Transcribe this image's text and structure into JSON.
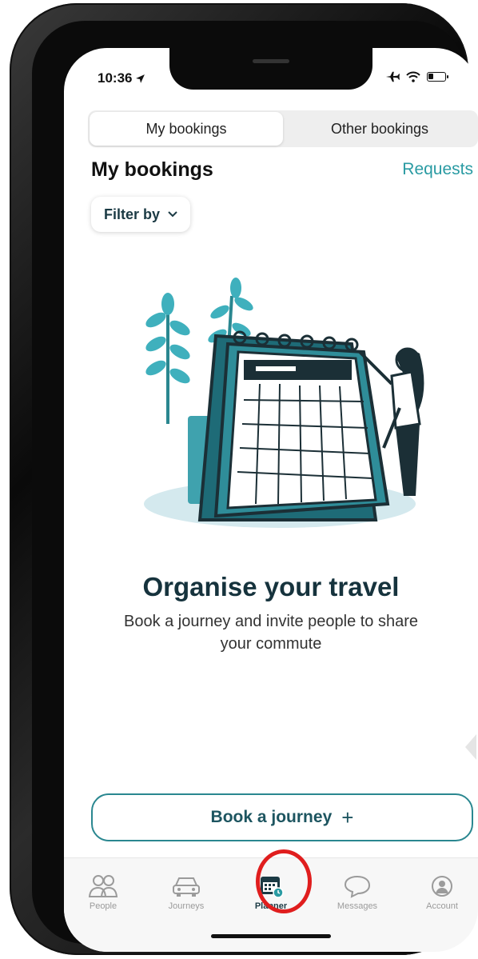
{
  "status": {
    "time": "10:36"
  },
  "segment": {
    "tabs": [
      "My bookings",
      "Other bookings"
    ]
  },
  "header": {
    "title": "My bookings",
    "requests": "Requests"
  },
  "filter": {
    "label": "Filter by"
  },
  "empty_state": {
    "title": "Organise your travel",
    "subtitle": "Book a journey and invite people to share your commute"
  },
  "book_button": {
    "label": "Book a journey",
    "plus": "+"
  },
  "tabbar": {
    "items": [
      {
        "label": "People",
        "icon": "people-icon"
      },
      {
        "label": "Journeys",
        "icon": "car-icon"
      },
      {
        "label": "Planner",
        "icon": "calendar-icon"
      },
      {
        "label": "Messages",
        "icon": "chat-bubble-icon"
      },
      {
        "label": "Account",
        "icon": "user-circle-icon"
      }
    ],
    "active": "Planner"
  },
  "colors": {
    "accent": "#2a9ba3",
    "dark": "#1b3a44",
    "highlight": "#e01e1e"
  }
}
